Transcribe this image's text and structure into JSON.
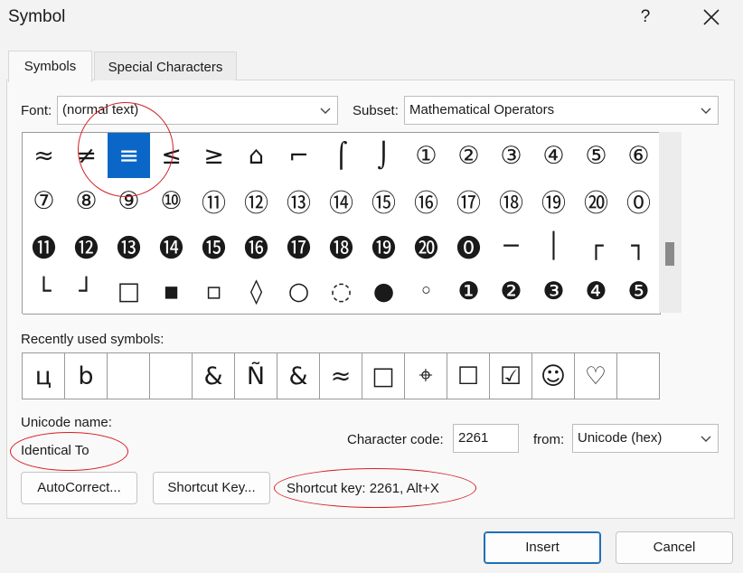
{
  "window": {
    "title": "Symbol",
    "help_glyph": "?",
    "close_glyph": "✕"
  },
  "tabs": [
    {
      "label": "Symbols",
      "active": true
    },
    {
      "label": "Special Characters",
      "active": false
    }
  ],
  "font": {
    "label": "Font:",
    "value": "(normal text)"
  },
  "subset": {
    "label": "Subset:",
    "value": "Mathematical Operators"
  },
  "symbol_grid": {
    "selected_index": 2,
    "rows": [
      [
        "≈",
        "≠",
        "≡",
        "≤",
        "≥",
        "⌂",
        "⌐",
        "⌠",
        "⌡",
        "①",
        "②",
        "③",
        "④",
        "⑤",
        "⑥"
      ],
      [
        "⑦",
        "⑧",
        "⑨",
        "⑩",
        "⑪",
        "⑫",
        "⑬",
        "⑭",
        "⑮",
        "⑯",
        "⑰",
        "⑱",
        "⑲",
        "⑳",
        "⓪"
      ],
      [
        "⓫",
        "⓬",
        "⓭",
        "⓮",
        "⓯",
        "⓰",
        "⓱",
        "⓲",
        "⓳",
        "⓴",
        "⓿",
        "─",
        "│",
        "┌",
        "┐"
      ],
      [
        "└",
        "┘",
        "□",
        "▪",
        "▫",
        "◊",
        "○",
        "◌",
        "●",
        "◦",
        "❶",
        "❷",
        "❸",
        "❹",
        "❺"
      ]
    ]
  },
  "recent": {
    "label": "Recently used symbols:",
    "items": [
      "ц",
      "b",
      "",
      "",
      "&",
      "Ñ",
      "&",
      "≈",
      "□",
      "⌖",
      "☐",
      "☑",
      "☺",
      "♡",
      ""
    ]
  },
  "unicode": {
    "label": "Unicode name:",
    "value": "Identical To"
  },
  "char_code": {
    "label": "Character code:",
    "value": "2261"
  },
  "from": {
    "label": "from:",
    "value": "Unicode (hex)"
  },
  "buttons": {
    "autocorrect": "AutoCorrect...",
    "shortcut_key": "Shortcut Key...",
    "insert": "Insert",
    "cancel": "Cancel"
  },
  "shortcut_text": "Shortcut key: 2261, Alt+X",
  "colors": {
    "selection": "#0a67c7",
    "annotation": "#d31f25"
  }
}
